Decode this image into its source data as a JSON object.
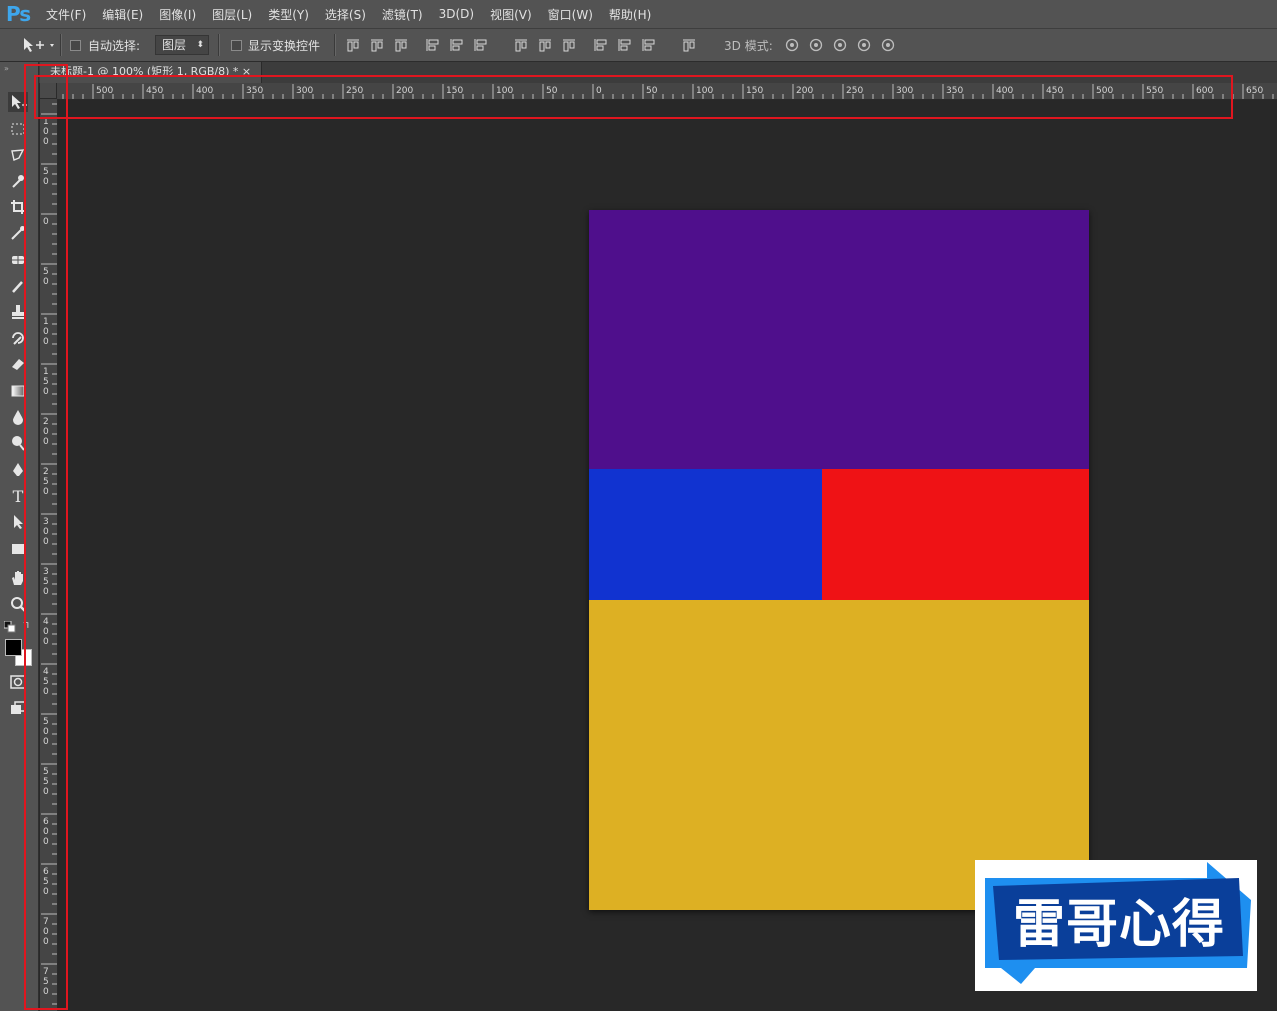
{
  "app": {
    "logo": "Ps"
  },
  "menu": [
    "文件(F)",
    "编辑(E)",
    "图像(I)",
    "图层(L)",
    "类型(Y)",
    "选择(S)",
    "滤镜(T)",
    "3D(D)",
    "视图(V)",
    "窗口(W)",
    "帮助(H)"
  ],
  "options": {
    "auto_select_label": "自动选择:",
    "auto_select_value": "图层",
    "show_transform_label": "显示变换控件",
    "mode_3d_label": "3D 模式:"
  },
  "document_tab": {
    "title": "未标题-1 @ 100% (矩形 1, RGB/8) *",
    "close": "×"
  },
  "rulers": {
    "horizontal_labels": [
      "500",
      "450",
      "400",
      "350",
      "300",
      "250",
      "200",
      "150",
      "100",
      "50",
      "0",
      "50",
      "100",
      "150",
      "200",
      "250",
      "300",
      "350",
      "400",
      "450",
      "500",
      "550",
      "600",
      "650"
    ],
    "vertical_labels": [
      "100",
      "50",
      "0",
      "50",
      "100",
      "150",
      "200",
      "250",
      "300",
      "350",
      "400",
      "450",
      "500",
      "550",
      "600",
      "650",
      "700",
      "750"
    ]
  },
  "canvas": {
    "colors": {
      "purple": "#4f0f8c",
      "blue": "#1133d0",
      "red": "#ef1215",
      "gold": "#ddb023"
    }
  },
  "colors": {
    "foreground": "#000000",
    "background": "#ffffff",
    "annotation": "#e0161f"
  },
  "watermark": {
    "text": "雷哥心得",
    "box_color": "#0a3f9a",
    "accent": "#1e8ff0"
  }
}
